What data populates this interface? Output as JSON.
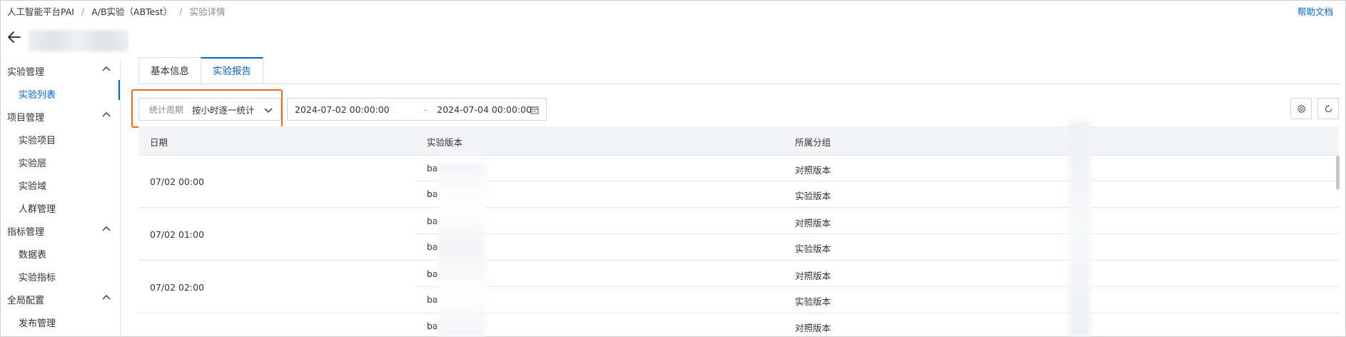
{
  "breadcrumb": {
    "items": [
      "人工智能平台PAI",
      "A/B实验（ABTest）",
      "实验详情"
    ],
    "separator": "/"
  },
  "header": {
    "help_label": "帮助文档"
  },
  "sidebar": {
    "groups": [
      {
        "label": "实验管理",
        "items": [
          "实验列表"
        ]
      },
      {
        "label": "项目管理",
        "items": [
          "实验项目",
          "实验层",
          "实验域",
          "人群管理"
        ]
      },
      {
        "label": "指标管理",
        "items": [
          "数据表",
          "实验指标"
        ]
      },
      {
        "label": "全局配置",
        "items": [
          "发布管理"
        ]
      }
    ],
    "active_item": "实验列表"
  },
  "tabs": [
    {
      "label": "基本信息",
      "active": false
    },
    {
      "label": "实验报告",
      "active": true
    }
  ],
  "filters": {
    "period_label": "统计周期",
    "period_value": "按小时逐一统计",
    "start_date": "2024-07-02 00:00:00",
    "end_date": "2024-07-04 00:00:00",
    "date_separator": "-"
  },
  "table": {
    "columns": [
      "日期",
      "实验版本",
      "所属分组"
    ],
    "rows": [
      {
        "date": "07/02 00:00",
        "versions": [
          {
            "version": "ba",
            "group": "对照版本"
          },
          {
            "version": "ba",
            "group": "实验版本"
          }
        ]
      },
      {
        "date": "07/02 01:00",
        "versions": [
          {
            "version": "ba",
            "group": "对照版本"
          },
          {
            "version": "ba",
            "group": "实验版本"
          }
        ]
      },
      {
        "date": "07/02 02:00",
        "versions": [
          {
            "version": "ba",
            "group": "对照版本"
          },
          {
            "version": "ba",
            "group": "实验版本"
          }
        ]
      },
      {
        "date": "",
        "versions": [
          {
            "version": "ba",
            "group": "对照版本"
          }
        ]
      }
    ]
  },
  "colors": {
    "accent": "#0064c8",
    "highlight": "#e9691e"
  }
}
